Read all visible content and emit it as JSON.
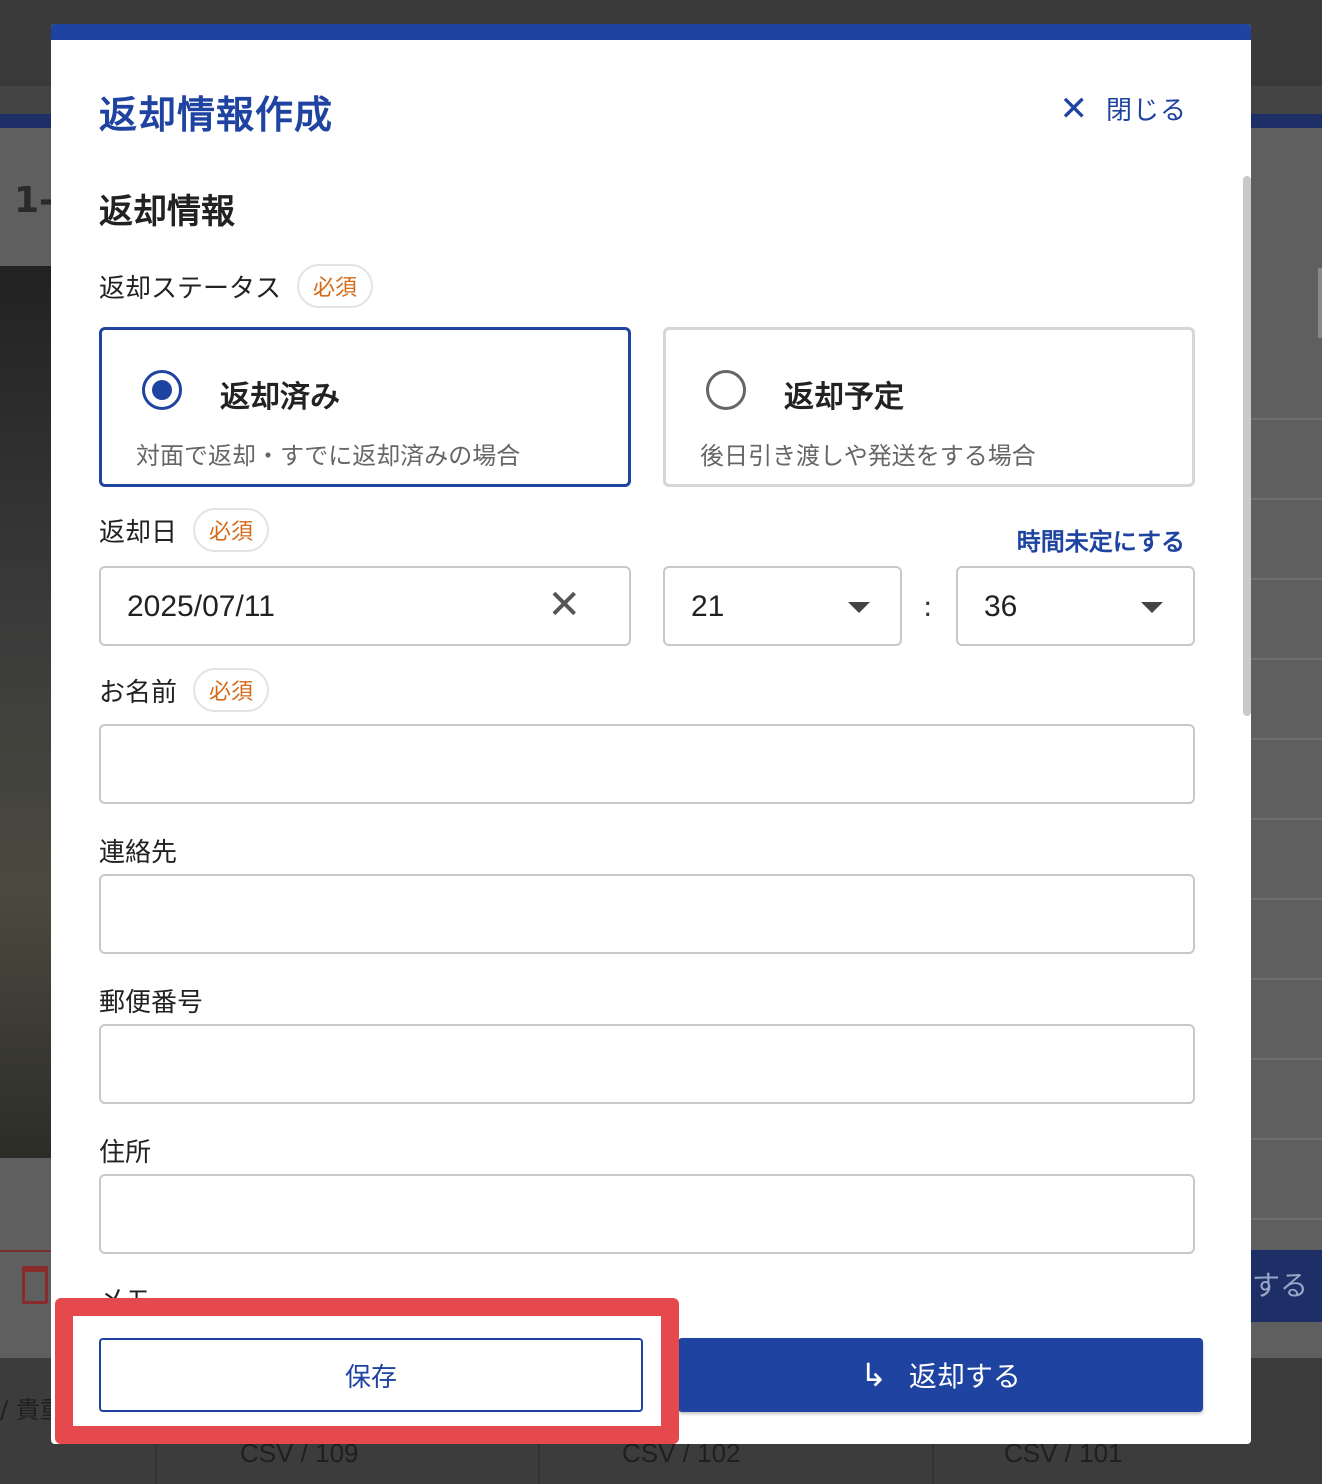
{
  "background": {
    "heading": "1-",
    "right_button_label": "する",
    "left_text": "/ 貴重",
    "bottom_items": [
      "CSV / 109",
      "CSV / 102",
      "CSV / 101"
    ]
  },
  "modal": {
    "title": "返却情報作成",
    "close_label": "閉じる",
    "section_title": "返却情報",
    "required_badge": "必須",
    "status": {
      "label": "返却ステータス",
      "options": [
        {
          "title": "返却済み",
          "description": "対面で返却・すでに返却済みの場合",
          "selected": true
        },
        {
          "title": "返却予定",
          "description": "後日引き渡しや発送をする場合",
          "selected": false
        }
      ]
    },
    "return_date": {
      "label": "返却日",
      "time_undecided_link": "時間未定にする",
      "date_value": "2025/07/11",
      "hour_value": "21",
      "minute_value": "36",
      "separator": ":"
    },
    "name": {
      "label": "お名前",
      "value": ""
    },
    "contact": {
      "label": "連絡先",
      "value": ""
    },
    "postal_code": {
      "label": "郵便番号",
      "value": ""
    },
    "address": {
      "label": "住所",
      "value": ""
    },
    "memo": {
      "label": "メモ"
    },
    "footer": {
      "save_label": "保存",
      "return_label": "返却する"
    }
  },
  "colors": {
    "accent": "#1f43a0",
    "required": "#d46a1a",
    "highlight": "#e5484d"
  }
}
